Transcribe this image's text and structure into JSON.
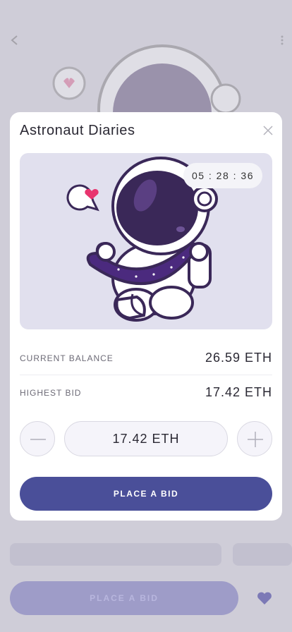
{
  "modal": {
    "title": "Astronaut Diaries",
    "timer": "05 : 28 : 36",
    "current_balance_label": "CURRENT BALANCE",
    "current_balance_value": "26.59 ETH",
    "highest_bid_label": "HIGHEST BID",
    "highest_bid_value": "17.42 ETH",
    "bid_value": "17.42 ETH",
    "place_bid_label": "PLACE A BID"
  },
  "background": {
    "place_bid_label": "PLACE A BID"
  },
  "colors": {
    "accent": "#4a4f99",
    "art_background": "#e1e0ee",
    "overlay": "#cfcdd8"
  }
}
